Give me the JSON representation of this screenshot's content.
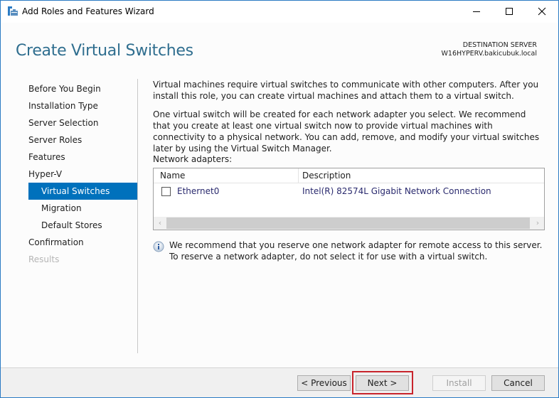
{
  "window": {
    "title": "Add Roles and Features Wizard",
    "controls": {
      "minimize": "minimize",
      "maximize": "maximize",
      "close": "close"
    }
  },
  "header": {
    "page_title": "Create Virtual Switches",
    "destination_label": "DESTINATION SERVER",
    "destination_server": "W16HYPERV.bakicubuk.local"
  },
  "sidebar": {
    "items": [
      {
        "label": "Before You Begin",
        "state": "normal",
        "level": 0
      },
      {
        "label": "Installation Type",
        "state": "normal",
        "level": 0
      },
      {
        "label": "Server Selection",
        "state": "normal",
        "level": 0
      },
      {
        "label": "Server Roles",
        "state": "normal",
        "level": 0
      },
      {
        "label": "Features",
        "state": "normal",
        "level": 0
      },
      {
        "label": "Hyper-V",
        "state": "normal",
        "level": 0
      },
      {
        "label": "Virtual Switches",
        "state": "active",
        "level": 1
      },
      {
        "label": "Migration",
        "state": "normal",
        "level": 1
      },
      {
        "label": "Default Stores",
        "state": "normal",
        "level": 1
      },
      {
        "label": "Confirmation",
        "state": "normal",
        "level": 0
      },
      {
        "label": "Results",
        "state": "disabled",
        "level": 0
      }
    ]
  },
  "content": {
    "paragraph1": "Virtual machines require virtual switches to communicate with other computers. After you install this role, you can create virtual machines and attach them to a virtual switch.",
    "paragraph2": "One virtual switch will be created for each network adapter you select. We recommend that you create at least one virtual switch now to provide virtual machines with connectivity to a physical network. You can add, remove, and modify your virtual switches later by using the Virtual Switch Manager.",
    "adapters_label": "Network adapters:",
    "table": {
      "columns": [
        "Name",
        "Description"
      ],
      "rows": [
        {
          "checked": false,
          "name": "Ethernet0",
          "description": "Intel(R) 82574L Gigabit Network Connection"
        }
      ]
    },
    "info_text": "We recommend that you reserve one network adapter for remote access to this server. To reserve a network adapter, do not select it for use with a virtual switch."
  },
  "footer": {
    "previous_label": "< Previous",
    "next_label": "Next >",
    "install_label": "Install",
    "cancel_label": "Cancel"
  },
  "colors": {
    "accent": "#0071bc",
    "title": "#2f6e8f",
    "highlight": "#c8242c"
  }
}
